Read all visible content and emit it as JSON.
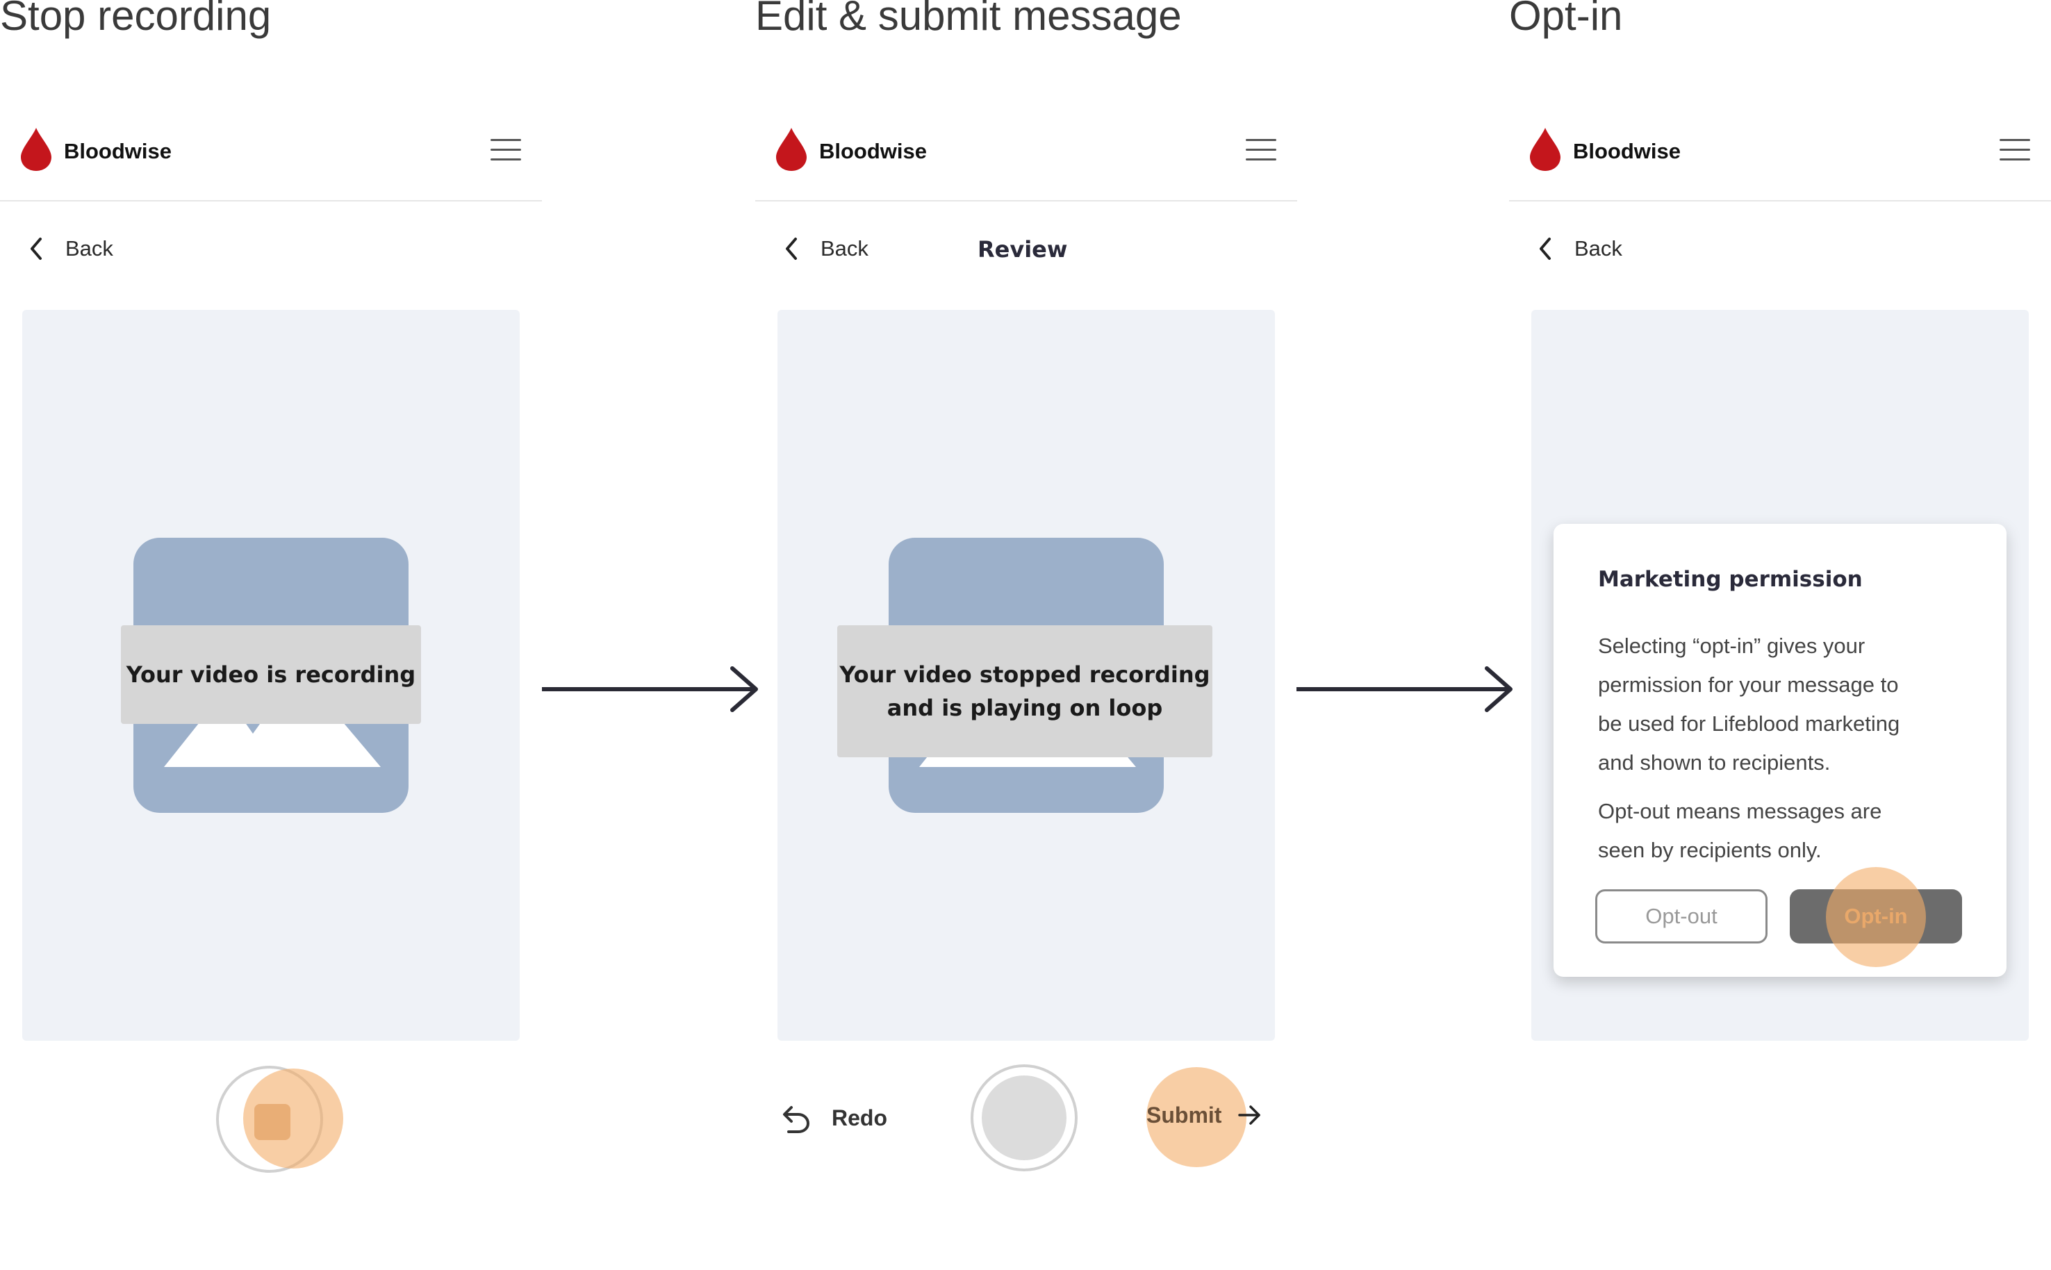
{
  "steps": [
    {
      "title": "Stop recording",
      "brand": "Bloodwise",
      "back_label": "Back",
      "caption": "Your video is recording"
    },
    {
      "title": "Edit & submit message",
      "brand": "Bloodwise",
      "back_label": "Back",
      "screen_title": "Review",
      "caption_line1": "Your video stopped recording",
      "caption_line2": "and is playing on loop",
      "redo_label": "Redo",
      "submit_label": "Submit"
    },
    {
      "title": "Opt-in",
      "brand": "Bloodwise",
      "back_label": "Back",
      "modal": {
        "title": "Marketing permission",
        "paragraph1_lines": [
          "Selecting “opt-in” gives your",
          "permission for your message to",
          "be used for Lifeblood marketing",
          "and shown to recipients."
        ],
        "paragraph2_lines": [
          "Opt-out means messages are",
          "seen by recipients only."
        ],
        "opt_out_label": "Opt-out",
        "opt_in_label": "Opt-in"
      }
    }
  ],
  "icons": {
    "brand": "blood-drop-icon",
    "menu": "hamburger-menu-icon",
    "back": "chevron-left-icon",
    "media": "image-placeholder-icon",
    "redo": "undo-arrow-icon",
    "submit": "arrow-right-icon",
    "flow": "long-arrow-right-icon"
  },
  "colors": {
    "brand_red": "#c4161c",
    "highlight": "#f3ad69",
    "video_bg": "#eff2f7",
    "placeholder": "#9cb0ca",
    "caption_bg": "#d6d6d6",
    "opt_in_bg": "#6c6c6c"
  }
}
